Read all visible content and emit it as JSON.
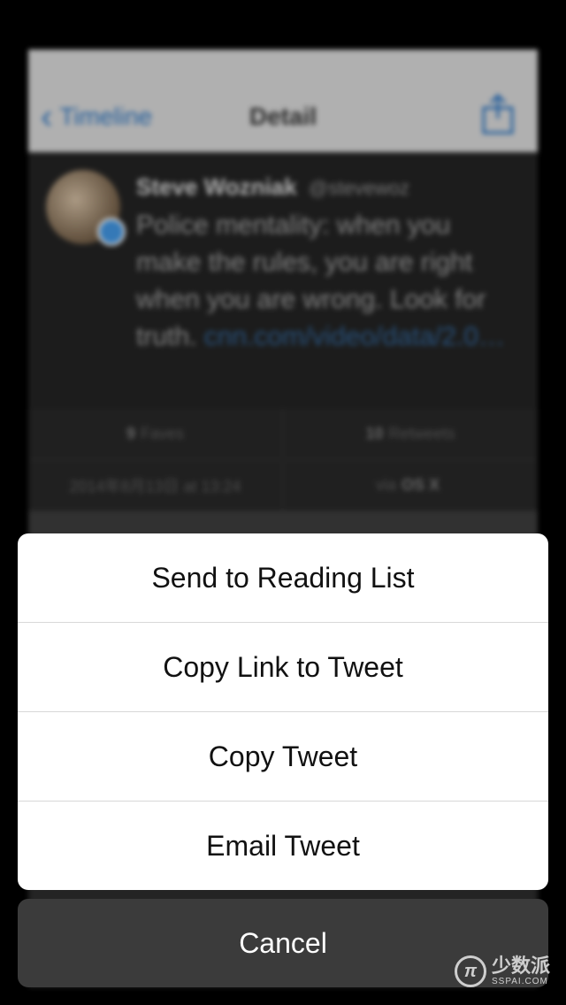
{
  "background_app": {
    "nav": {
      "back_label": "Timeline",
      "title": "Detail"
    },
    "tweet": {
      "name": "Steve Wozniak",
      "handle": "@stevewoz",
      "text": "Police mentality: when you make the rules, you are right when you are wrong. Look for truth.",
      "link": "cnn.com/video/data/2.0…"
    },
    "stats": {
      "faves_count": "9",
      "faves_label": "Faves",
      "retweets_count": "10",
      "retweets_label": "Retweets",
      "date": "2014年8月13日 at 13:24",
      "via_prefix": "via",
      "via_app": "OS X"
    }
  },
  "action_sheet": {
    "items": [
      {
        "label": "Send to Reading List"
      },
      {
        "label": "Copy Link to Tweet"
      },
      {
        "label": "Copy Tweet"
      },
      {
        "label": "Email Tweet"
      }
    ],
    "cancel_label": "Cancel"
  },
  "watermark": {
    "logo": "π",
    "text_cn": "少数派",
    "text_en": "SSPAI.COM"
  },
  "colors": {
    "link_blue": "#2a6fb8",
    "sheet_bg": "#ffffff",
    "cancel_bg": "#3b3b3b",
    "verified_badge": "#3f8fd8"
  }
}
